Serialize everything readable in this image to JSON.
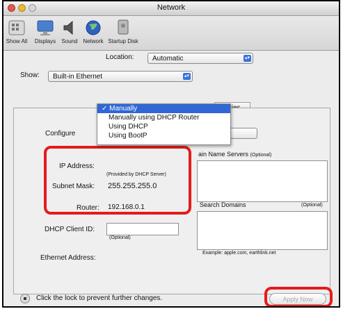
{
  "window": {
    "title": "Network"
  },
  "toolbar": {
    "items": [
      {
        "label": "Show All",
        "icon": "show-all-icon"
      },
      {
        "label": "Displays",
        "icon": "display-icon"
      },
      {
        "label": "Sound",
        "icon": "sound-icon"
      },
      {
        "label": "Network",
        "icon": "network-globe-icon"
      },
      {
        "label": "Startup Disk",
        "icon": "startup-disk-icon"
      }
    ]
  },
  "location": {
    "label": "Location:",
    "value": "Automatic"
  },
  "show": {
    "label": "Show:",
    "value": "Built-in Ethernet"
  },
  "tabs": {
    "partial": "oxies"
  },
  "configure": {
    "label": "Configure",
    "menu": [
      "✓ Manually",
      "Manually using DHCP Router",
      "Using DHCP",
      "Using BootP"
    ]
  },
  "ip": {
    "ip_label": "IP Address:",
    "provided_note": "(Provided by DHCP Server)",
    "subnet_label": "Subnet Mask:",
    "subnet_value": "255.255.255.0",
    "router_label": "Router:",
    "router_value": "192.168.0.1"
  },
  "dhcp": {
    "label": "DHCP Client ID:",
    "note": "(Optional)"
  },
  "ethernet": {
    "label": "Ethernet Address:"
  },
  "dns": {
    "label": "ain Name Servers",
    "optional": "(Optional)"
  },
  "search": {
    "label": "Search Domains",
    "optional": "(Optional)",
    "example": "Example: apple.com, earthlink.net"
  },
  "footer": {
    "lock_text": "Click the lock to prevent further changes.",
    "apply_label": "Apply Now"
  },
  "colors": {
    "highlight_red": "#e41b1b",
    "menu_selection": "#2f67d6"
  }
}
